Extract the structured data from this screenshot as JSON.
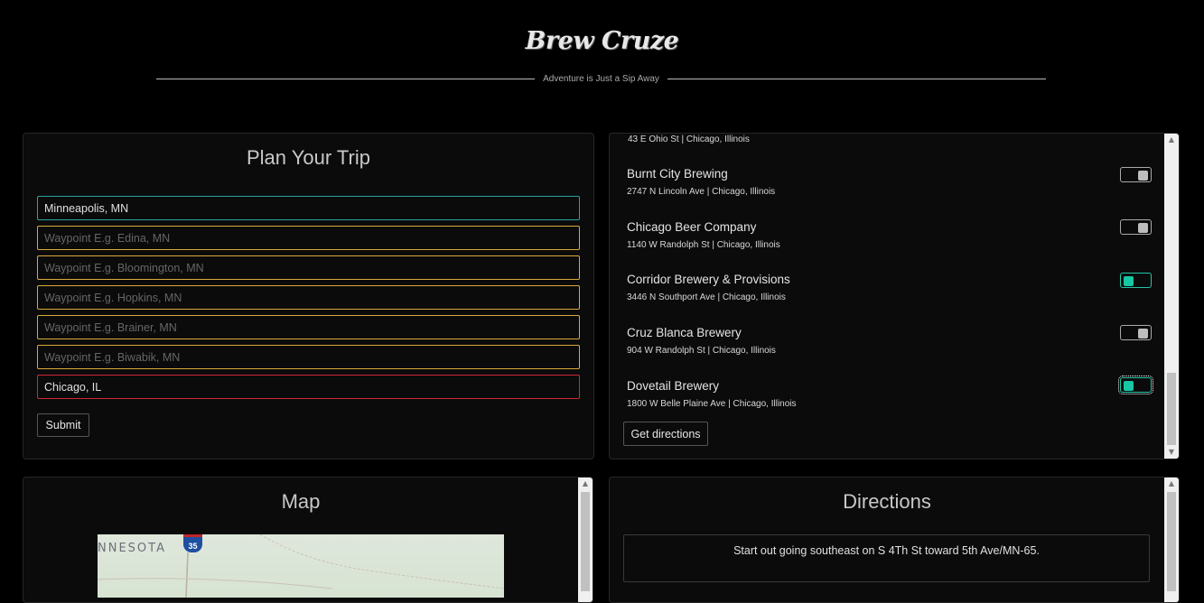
{
  "header": {
    "brand": "Brew Cruze",
    "tagline": "Adventure is Just a Sip Away"
  },
  "plan": {
    "title": "Plan Your Trip",
    "start_value": "Minneapolis, MN",
    "waypoints": [
      "Waypoint E.g. Edina, MN",
      "Waypoint E.g. Bloomington, MN",
      "Waypoint E.g. Hopkins, MN",
      "Waypoint E.g. Brainer, MN",
      "Waypoint E.g. Biwabik, MN"
    ],
    "end_value": "Chicago, IL",
    "submit_label": "Submit"
  },
  "breweries": {
    "partial_address": "43 E Ohio St | Chicago, Illinois",
    "items": [
      {
        "name": "Burnt City Brewing",
        "address": "2747 N Lincoln Ave | Chicago, Illinois",
        "selected": false
      },
      {
        "name": "Chicago Beer Company",
        "address": "1140 W Randolph St | Chicago, Illinois",
        "selected": false
      },
      {
        "name": "Corridor Brewery & Provisions",
        "address": "3446 N Southport Ave | Chicago, Illinois",
        "selected": true
      },
      {
        "name": "Cruz Blanca Brewery",
        "address": "904 W Randolph St | Chicago, Illinois",
        "selected": false
      },
      {
        "name": "Dovetail Brewery",
        "address": "1800 W Belle Plaine Ave | Chicago, Illinois",
        "selected": true
      }
    ],
    "get_directions_label": "Get directions"
  },
  "map": {
    "title": "Map",
    "region_label": "NNESOTA",
    "shield_number": "35"
  },
  "directions": {
    "title": "Directions",
    "steps": [
      "Start out going southeast on S 4Th St toward 5th Ave/MN-65."
    ]
  },
  "colors": {
    "start_border": "#2aa39a",
    "waypoint_border": "#d9a93c",
    "end_border": "#d0283a",
    "toggle_on": "#18c7a3"
  }
}
